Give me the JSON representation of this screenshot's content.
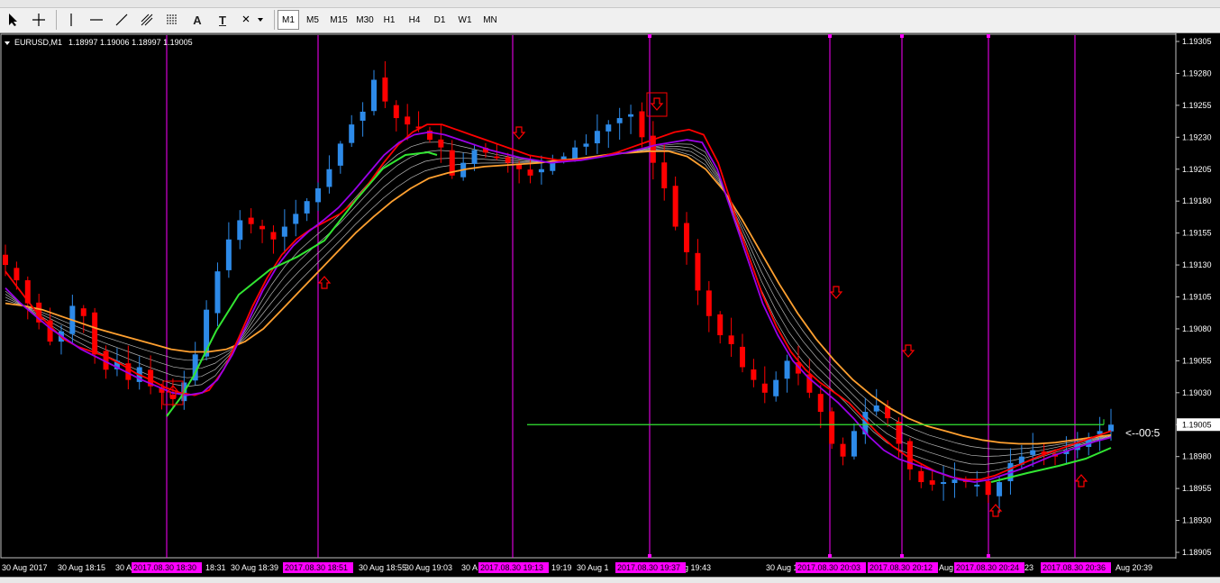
{
  "toolbar": {
    "tools": [
      "cursor-icon",
      "crosshair-icon",
      "vertical-line-icon",
      "horizontal-line-icon",
      "trendline-icon",
      "fibonacci-icon",
      "grid-icon",
      "text-icon",
      "label-icon",
      "shapes-icon"
    ],
    "text_tool_label": "A",
    "label_tool_label": "T",
    "timeframes": [
      "M1",
      "M5",
      "M15",
      "M30",
      "H1",
      "H4",
      "D1",
      "W1",
      "MN"
    ],
    "active_timeframe": "M1"
  },
  "chart_header": {
    "symbol": "EURUSD,M1",
    "ohlc": "1.18997 1.19006 1.18997 1.19005"
  },
  "colors": {
    "background": "#000000",
    "bull": "#2d8ae8",
    "bear": "#ff0000",
    "ema_fast": "#ff0000",
    "ema_purple": "#9b00e8",
    "ema_slow": "#ffa030",
    "trend_up": "#32e632",
    "ribbon": "#b4b4b4",
    "price_line": "#32e632",
    "session_line": "#ff00ff",
    "arrow": "#ff0000"
  },
  "price_axis": {
    "ticks": [
      "1.19305",
      "1.19280",
      "1.19255",
      "1.19230",
      "1.19205",
      "1.19180",
      "1.19155",
      "1.19130",
      "1.19105",
      "1.19080",
      "1.19055",
      "1.19030",
      "1.19005",
      "1.18980",
      "1.18955",
      "1.18930",
      "1.18905"
    ],
    "current_price": "1.19005",
    "countdown": "<--00:5"
  },
  "time_axis": {
    "labels": [
      "30 Aug 2017",
      "30 Aug 18:15",
      "30 A",
      "18:31",
      "30 Aug 18:39",
      "30 Aug 18:55",
      "30 Aug 19:03",
      "30 A",
      "19:19",
      "30 Aug 1",
      "30 Aug 19:43",
      "30 Aug 19:5",
      "Aug",
      "23",
      "Aug 20:39"
    ],
    "session_tags": [
      "2017.08.30 18:30",
      "2017.08.30 18:51",
      "2017.08.30 19:13",
      "2017.08.30 19:37",
      "2017.08.30 20:03",
      "2017.08.30 20:12",
      "2017.08.30 20:24",
      "2017.08.30 20:36"
    ]
  },
  "chart_data": {
    "type": "candlestick",
    "symbol": "EURUSD",
    "timeframe": "M1",
    "ylim": [
      1.18895,
      1.19315
    ],
    "grid": false,
    "current_price": 1.19005,
    "horizontal_line": 1.19005,
    "session_markers": [
      "2017.08.30 18:30",
      "2017.08.30 18:51",
      "2017.08.30 19:13",
      "2017.08.30 19:37",
      "2017.08.30 20:03",
      "2017.08.30 20:12",
      "2017.08.30 20:24",
      "2017.08.30 20:36"
    ],
    "signals": [
      {
        "type": "buy",
        "price": 1.19032
      },
      {
        "type": "buy",
        "price": 1.19118
      },
      {
        "type": "sell",
        "price": 1.19235
      },
      {
        "type": "sell",
        "price": 1.19265
      },
      {
        "type": "sell",
        "price": 1.19112
      },
      {
        "type": "sell",
        "price": 1.1908
      },
      {
        "type": "buy",
        "price": 1.18946
      },
      {
        "type": "buy",
        "price": 1.18958
      }
    ],
    "price_path": [
      1.1913,
      1.19118,
      1.191,
      1.19085,
      1.1907,
      1.19078,
      1.19098,
      1.1909,
      1.1906,
      1.19048,
      1.19055,
      1.1904,
      1.1905,
      1.19035,
      1.1903,
      1.19025,
      1.19038,
      1.1906,
      1.19095,
      1.19125,
      1.1915,
      1.19165,
      1.19162,
      1.19158,
      1.1915,
      1.1916,
      1.1917,
      1.1918,
      1.1919,
      1.19205,
      1.19225,
      1.1924,
      1.1925,
      1.19275,
      1.19258,
      1.19245,
      1.1924,
      1.19238,
      1.19228,
      1.19222,
      1.192,
      1.1921,
      1.1922,
      1.19218,
      1.19215,
      1.1921,
      1.19205,
      1.192,
      1.19205,
      1.1921,
      1.19215,
      1.19222,
      1.19225,
      1.19235,
      1.1924,
      1.19245,
      1.19248,
      1.1923,
      1.1921,
      1.1919,
      1.1916,
      1.1914,
      1.1911,
      1.1909,
      1.19075,
      1.19068,
      1.1905,
      1.1904,
      1.1903,
      1.1904,
      1.19055,
      1.19045,
      1.1903,
      1.19015,
      1.1899,
      1.1898,
      1.19,
      1.19015,
      1.1902,
      1.1901,
      1.1899,
      1.1897,
      1.1896,
      1.18958,
      1.1896,
      1.18962,
      1.1896,
      1.18958,
      1.1895,
      1.1896,
      1.18975,
      1.1898,
      1.18985,
      1.18982,
      1.1898,
      1.18985,
      1.1899,
      1.18995,
      1.19,
      1.19005
    ],
    "series": [
      {
        "values": [
          1.19125,
          1.1911,
          1.19095,
          1.19083,
          1.19072,
          1.19066,
          1.19062,
          1.19058,
          1.19052,
          1.19045,
          1.1904,
          1.19034,
          1.1903,
          1.19028,
          1.19032,
          1.19048,
          1.19072,
          1.19098,
          1.1912,
          1.19138,
          1.1915,
          1.19158,
          1.19164,
          1.1917,
          1.1918,
          1.19194,
          1.1921,
          1.19224,
          1.19234,
          1.1924,
          1.1924,
          1.19236,
          1.19232,
          1.19228,
          1.19224,
          1.1922,
          1.19216,
          1.19214,
          1.19212,
          1.19212,
          1.19213,
          1.19215,
          1.19218,
          1.19222,
          1.19226,
          1.1923,
          1.19234,
          1.19236,
          1.19232,
          1.1921,
          1.19175,
          1.1914,
          1.19108,
          1.19082,
          1.19062,
          1.19048,
          1.19038,
          1.1903,
          1.19022,
          1.1901,
          1.18998,
          1.18988,
          1.1898,
          1.18974,
          1.18968,
          1.18964,
          1.18962,
          1.18962,
          1.18965,
          1.1897,
          1.18975,
          1.1898,
          1.18984,
          1.18988,
          1.18992,
          1.18996,
          1.19
        ]
      },
      {
        "values": [
          1.19112,
          1.191,
          1.1909,
          1.1908,
          1.19072,
          1.19064,
          1.19058,
          1.19052,
          1.19046,
          1.1904,
          1.19035,
          1.1903,
          1.19028,
          1.1903,
          1.1904,
          1.1906,
          1.19085,
          1.1911,
          1.1913,
          1.19145,
          1.19156,
          1.19165,
          1.19175,
          1.19188,
          1.19202,
          1.19216,
          1.19226,
          1.19232,
          1.19234,
          1.19232,
          1.19228,
          1.19224,
          1.1922,
          1.19217,
          1.19214,
          1.19212,
          1.1921,
          1.19211,
          1.19212,
          1.19214,
          1.19216,
          1.19218,
          1.19221,
          1.19224,
          1.19226,
          1.19228,
          1.19226,
          1.19205,
          1.1917,
          1.19135,
          1.191,
          1.19075,
          1.19055,
          1.19042,
          1.19032,
          1.19022,
          1.1901,
          1.18996,
          1.18985,
          1.18978,
          1.18974,
          1.1897,
          1.18966,
          1.18962,
          1.1896,
          1.18962,
          1.18966,
          1.1897,
          1.18975,
          1.1898,
          1.18984,
          1.18988,
          1.18992,
          1.18995
        ]
      },
      {
        "values": [
          1.191,
          1.19098,
          1.19095,
          1.1909,
          1.19085,
          1.1908,
          1.19076,
          1.19072,
          1.19068,
          1.19064,
          1.19062,
          1.19062,
          1.19064,
          1.1907,
          1.1908,
          1.19095,
          1.1911,
          1.19125,
          1.1914,
          1.19155,
          1.19168,
          1.1918,
          1.1919,
          1.19198,
          1.19202,
          1.19205,
          1.19207,
          1.19208,
          1.19209,
          1.1921,
          1.19212,
          1.19213,
          1.19215,
          1.19217,
          1.19218,
          1.19219,
          1.19219,
          1.19215,
          1.19205,
          1.19188,
          1.19165,
          1.1914,
          1.19115,
          1.19092,
          1.19072,
          1.19055,
          1.1904,
          1.19028,
          1.19018,
          1.1901,
          1.19004,
          1.19,
          1.18996,
          1.18993,
          1.18991,
          1.1899,
          1.1899,
          1.18991,
          1.18993,
          1.18995,
          1.18997
        ]
      }
    ]
  }
}
